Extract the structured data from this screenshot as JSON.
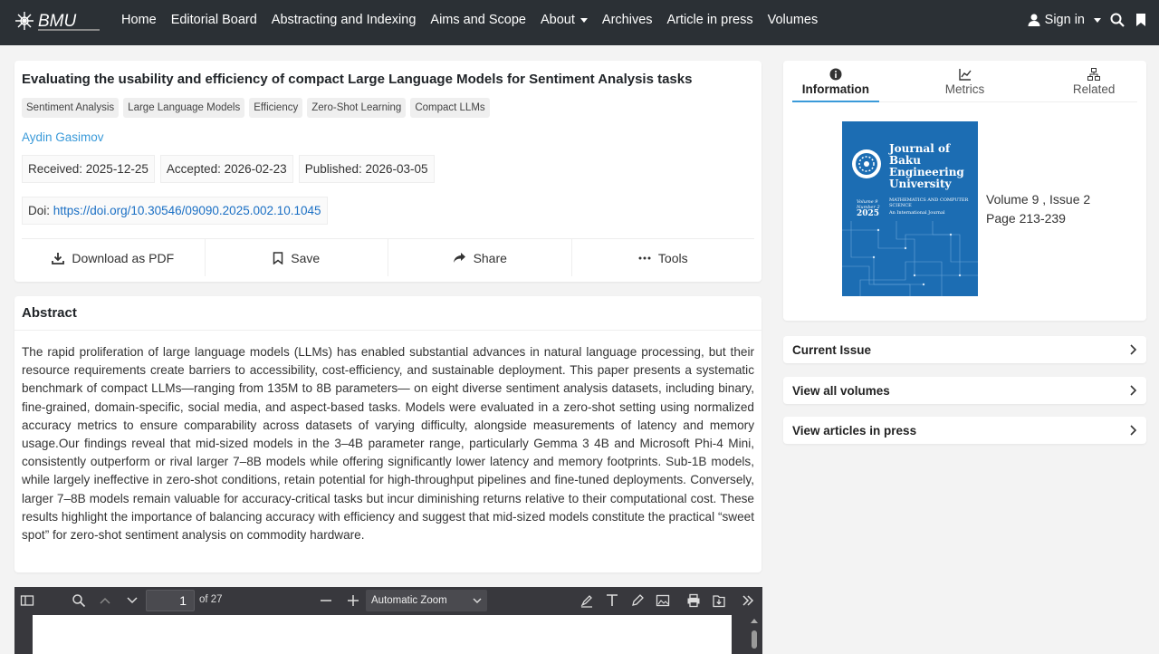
{
  "brand": {
    "logo_text": "BMU"
  },
  "nav": {
    "links": [
      "Home",
      "Editorial Board",
      "Abstracting and Indexing",
      "Aims and Scope",
      "About",
      "Archives",
      "Article in press",
      "Volumes"
    ],
    "signin": "Sign in"
  },
  "article": {
    "title": "Evaluating the usability and efficiency of compact Large Language Models for Sentiment Analysis tasks",
    "keywords": [
      "Sentiment Analysis",
      "Large Language Models",
      "Efficiency",
      "Zero-Shot Learning",
      "Compact LLMs"
    ],
    "author": "Aydin Gasimov",
    "received": "Received: 2025-12-25",
    "accepted": "Accepted: 2026-02-23",
    "published": "Published: 2026-03-05",
    "doi_label": "Doi:",
    "doi_url": "https://doi.org/10.30546/09090.2025.002.10.1045",
    "actions": {
      "download": "Download as PDF",
      "save": "Save",
      "share": "Share",
      "tools": "Tools"
    }
  },
  "abstract": {
    "heading": "Abstract",
    "text": "The rapid proliferation of large language models (LLMs) has enabled substantial advances in natural language processing, but their resource requirements create barriers to accessibility, cost-efficiency, and sustainable deployment. This paper presents a systematic benchmark of compact LLMs—ranging from 135M to 8B parameters— on eight diverse sentiment analysis datasets, including binary, fine-grained, domain-specific, social media, and aspect-based tasks. Models were evaluated in a zero-shot setting using normalized accuracy metrics to ensure comparability across datasets of varying difficulty, alongside measurements of latency and memory usage.Our findings reveal that mid-sized models in the 3–4B parameter range, particularly Gemma 3 4B and Microsoft Phi-4 Mini, consistently outperform or rival larger 7–8B models while offering significantly lower latency and memory footprints. Sub-1B models, while largely ineffective in zero-shot conditions, retain potential for high-throughput pipelines and fine-tuned deployments. Conversely, larger 7–8B models remain valuable for accuracy-critical tasks but incur diminishing returns relative to their computational cost. These results highlight the importance of balancing accuracy with efficiency and suggest that mid-sized models constitute the practical “sweet spot” for zero-shot sentiment analysis on commodity hardware."
  },
  "pdf": {
    "page": "1",
    "page_of": "of 27",
    "zoom": "Automatic Zoom"
  },
  "sidebar": {
    "tabs": [
      "Information",
      "Metrics",
      "Related"
    ],
    "cover": {
      "title": "Journal of Baku Engineering University",
      "subtitle": "MATHEMATICS AND COMPUTER SCIENCE",
      "volume": "Volume 9 Number 2",
      "year": "2025",
      "tagline": "An International Journal"
    },
    "volume_line": "Volume 9 , Issue 2",
    "page_line": "Page 213-239",
    "links": [
      "Current Issue",
      "View all volumes",
      "View articles in press"
    ]
  },
  "colors": {
    "navbar": "#2b3035",
    "link": "#1a6fc4",
    "author": "#3a9ad9",
    "cover": "#1c6db3"
  }
}
